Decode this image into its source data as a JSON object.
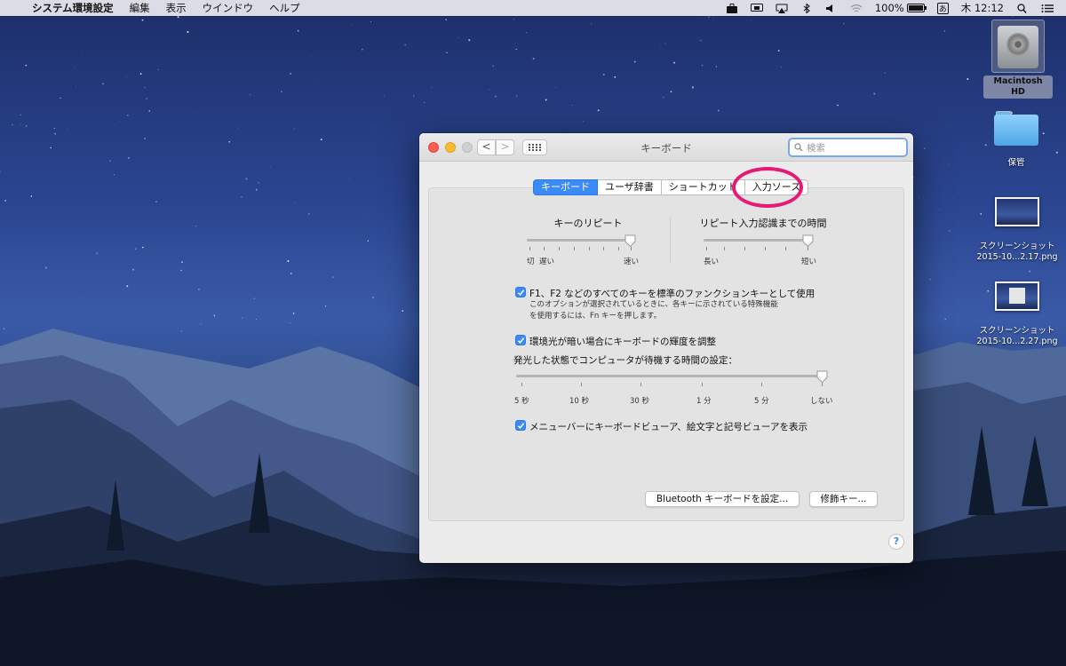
{
  "menubar": {
    "apple_glyph": "",
    "app_name": "システム環境設定",
    "menus": [
      "編集",
      "表示",
      "ウインドウ",
      "ヘルプ"
    ],
    "battery_percent": "100%",
    "input_method": "あ",
    "clock": "木 12:12"
  },
  "desktop": {
    "hd_label": "Macintosh HD",
    "folder_label": "保管",
    "screenshot1_label_line1": "スクリーンショット",
    "screenshot1_label_line2": "2015-10...2.17.png",
    "screenshot2_label_line1": "スクリーンショット",
    "screenshot2_label_line2": "2015-10...2.27.png"
  },
  "window": {
    "title": "キーボード",
    "search_placeholder": "検索",
    "nav_back": "<",
    "nav_forward": ">",
    "tabs": [
      {
        "label": "キーボード",
        "active": true
      },
      {
        "label": "ユーザ辞書",
        "active": false
      },
      {
        "label": "ショートカット",
        "active": false
      },
      {
        "label": "入力ソース",
        "active": false
      }
    ],
    "key_repeat": {
      "title": "キーのリピート",
      "label_off": "切",
      "label_slow": "遅い",
      "label_fast": "速い",
      "value_fraction": 1.0
    },
    "delay_until_repeat": {
      "title": "リピート入力認識までの時間",
      "label_long": "長い",
      "label_short": "短い",
      "value_fraction": 1.0
    },
    "fn_keys": {
      "checked": true,
      "label": "F1、F2 などのすべてのキーを標準のファンクションキーとして使用",
      "note_line1": "このオプションが選択されているときに、各キーに示されている特殊機能",
      "note_line2": "を使用するには、Fn キーを押します。"
    },
    "backlight": {
      "checked": true,
      "label": "環境光が暗い場合にキーボードの輝度を調整"
    },
    "backlight_timeout": {
      "title": "発光した状態でコンピュータが待機する時間の設定：",
      "ticks": [
        "5 秒",
        "10 秒",
        "30 秒",
        "1 分",
        "5 分",
        "しない"
      ],
      "value_fraction": 1.0
    },
    "viewer_menu": {
      "checked": true,
      "label": "メニューバーにキーボードビューア、絵文字と記号ビューアを表示"
    },
    "buttons": {
      "bluetooth": "Bluetooth キーボードを設定...",
      "modifier": "修飾キー..."
    },
    "help": "?"
  },
  "colors": {
    "accent": "#3a8bf7",
    "annotation_ring": "#e6187a"
  }
}
